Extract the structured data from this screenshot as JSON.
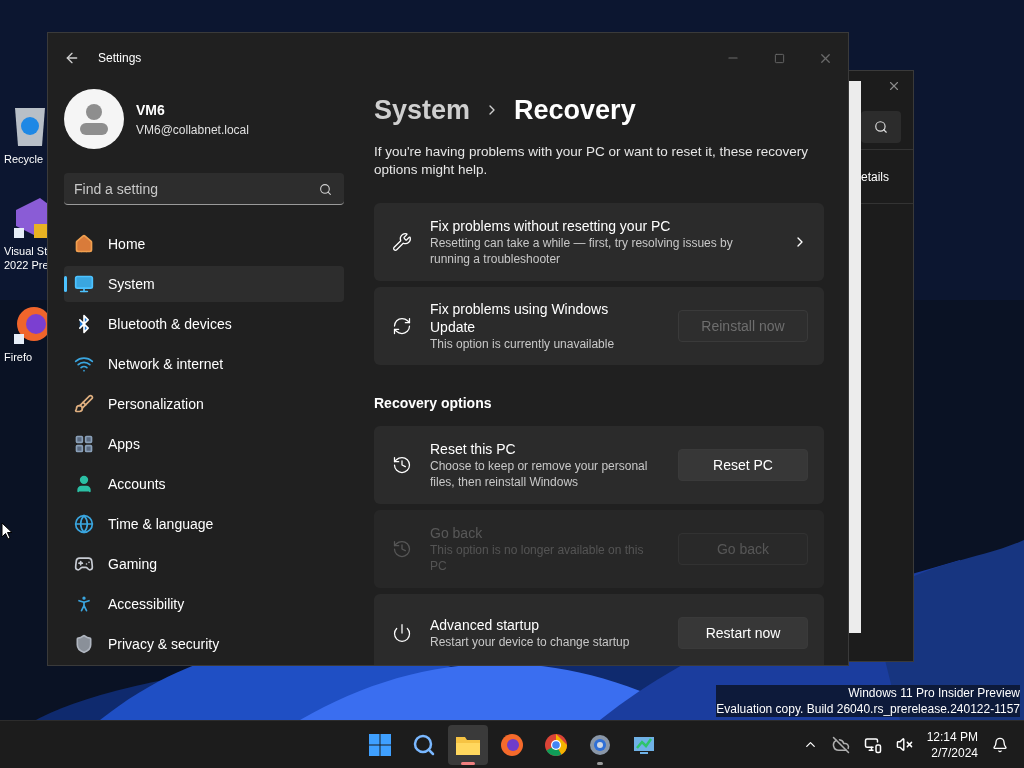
{
  "desktop": {
    "icons": [
      {
        "lines": [
          "Recycle"
        ]
      },
      {
        "lines": [
          "Visual St",
          "2022 Pre"
        ]
      },
      {
        "lines": [
          "Firefo"
        ]
      }
    ],
    "notice": [
      "Windows 11 Pro Insider Preview",
      "Evaluation copy. Build 26040.rs_prerelease.240122-1157"
    ]
  },
  "background_window": {
    "text": "etails"
  },
  "settings": {
    "title": "Settings",
    "user": {
      "name": "VM6",
      "email": "VM6@collabnet.local"
    },
    "search": {
      "placeholder": "Find a setting"
    },
    "nav": [
      {
        "label": "Home",
        "selected": false
      },
      {
        "label": "System",
        "selected": true
      },
      {
        "label": "Bluetooth & devices",
        "selected": false
      },
      {
        "label": "Network & internet",
        "selected": false
      },
      {
        "label": "Personalization",
        "selected": false
      },
      {
        "label": "Apps",
        "selected": false
      },
      {
        "label": "Accounts",
        "selected": false
      },
      {
        "label": "Time & language",
        "selected": false
      },
      {
        "label": "Gaming",
        "selected": false
      },
      {
        "label": "Accessibility",
        "selected": false
      },
      {
        "label": "Privacy & security",
        "selected": false
      }
    ],
    "breadcrumb": [
      "System",
      "Recovery"
    ],
    "intro": "If you're having problems with your PC or want to reset it, these recovery options might help.",
    "groups": [
      {
        "cards": [
          {
            "kind": "link",
            "title": "Fix problems without resetting your PC",
            "description": "Resetting can take a while — first, try resolving issues by running a troubleshooter",
            "disabled": false
          },
          {
            "kind": "button",
            "title": "Fix problems using Windows Update",
            "description": "This option is currently unavailable",
            "disabled": false,
            "button": {
              "label": "Reinstall now",
              "disabled": true
            }
          }
        ]
      },
      {
        "heading": "Recovery options",
        "cards": [
          {
            "kind": "button",
            "title": "Reset this PC",
            "description": "Choose to keep or remove your personal files, then reinstall Windows",
            "disabled": false,
            "button": {
              "label": "Reset PC",
              "disabled": false
            }
          },
          {
            "kind": "button",
            "title": "Go back",
            "description": "This option is no longer available on this PC",
            "disabled": true,
            "button": {
              "label": "Go back",
              "disabled": true
            }
          },
          {
            "kind": "button",
            "title": "Advanced startup",
            "description": "Restart your device to change startup",
            "disabled": false,
            "button": {
              "label": "Restart now",
              "disabled": false
            }
          }
        ]
      }
    ]
  },
  "taskbar": {
    "apps": [
      {
        "running": false,
        "active": false
      },
      {
        "running": false,
        "active": false
      },
      {
        "running": true,
        "active": true
      },
      {
        "running": false,
        "active": false
      },
      {
        "running": false,
        "active": false
      },
      {
        "running": true,
        "active": false
      },
      {
        "running": false,
        "active": false
      }
    ],
    "time": "12:14 PM",
    "date": "2/7/2024"
  }
}
